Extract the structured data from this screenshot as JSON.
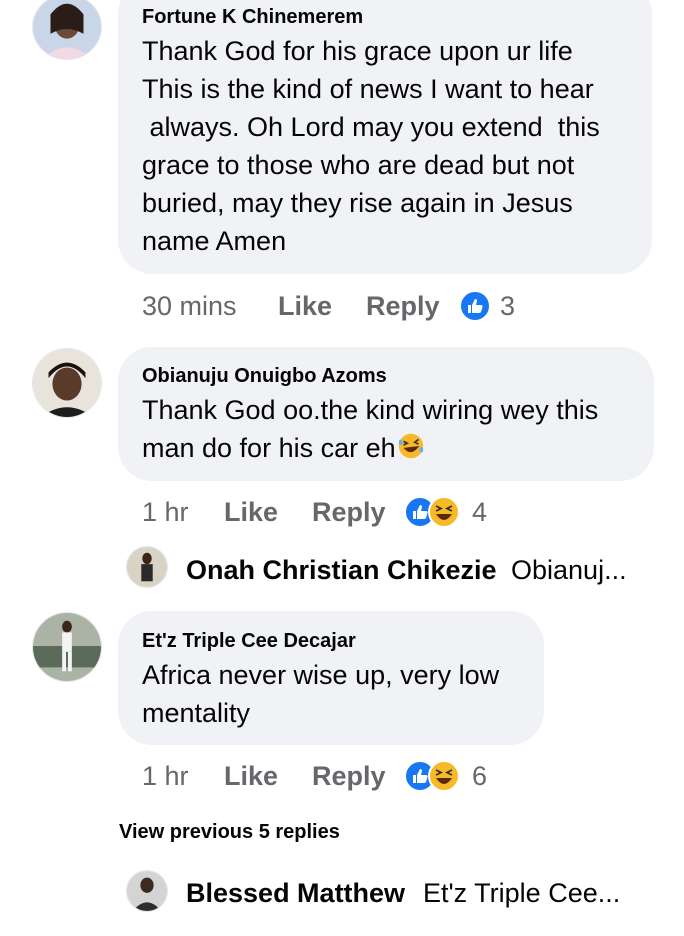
{
  "comments": [
    {
      "author": "Fortune K Chinemerem",
      "lines": [
        "Thank God for his grace upon ur life",
        "This is the kind of news I want to hear",
        " always. Oh Lord may you extend  this",
        "grace to those who are dead but not",
        "buried, may they rise again in Jesus",
        "name Amen"
      ],
      "time": "30 mins",
      "like_label": "Like",
      "reply_label": "Reply",
      "reaction_icons": [
        "like-icon"
      ],
      "reaction_count": "3"
    },
    {
      "author": "Obianuju Onuigbo Azoms",
      "lines": [
        "Thank God oo.the kind wiring wey this",
        "man do for his car eh"
      ],
      "inline_emoji": "laughing-emoji",
      "time": "1 hr",
      "like_label": "Like",
      "reply_label": "Reply",
      "reaction_icons": [
        "like-icon",
        "haha-icon"
      ],
      "reaction_count": "4"
    },
    {
      "author": "Et'z Triple Cee Decajar",
      "lines": [
        "Africa never wise up, very low",
        "mentality"
      ],
      "time": "1 hr",
      "like_label": "Like",
      "reply_label": "Reply",
      "reaction_icons": [
        "like-icon",
        "haha-icon"
      ],
      "reaction_count": "6"
    }
  ],
  "replies": [
    {
      "author": "Onah Christian Chikezie",
      "preview": "Obianuj..."
    },
    {
      "author": "Blessed Matthew",
      "preview": "Et'z Triple Cee..."
    }
  ],
  "view_previous": "View previous 5 replies",
  "colors": {
    "bubble": "#f0f2f5",
    "meta_text": "#65676b",
    "like_blue": "#1877f2",
    "haha_yellow": "#f7b928"
  }
}
